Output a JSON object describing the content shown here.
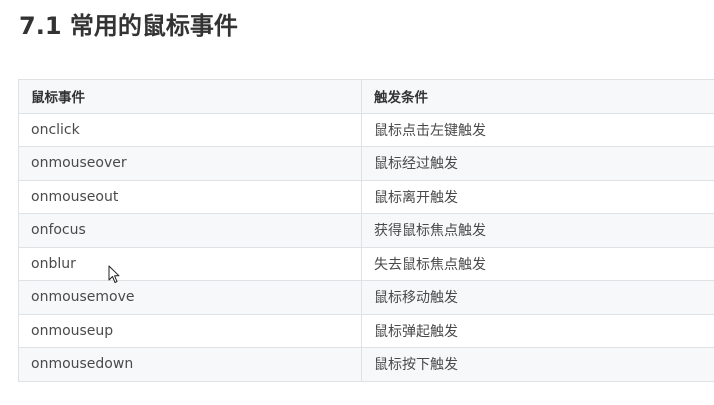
{
  "title": "7.1 常用的鼠标事件",
  "table": {
    "headers": [
      "鼠标事件",
      "触发条件"
    ],
    "rows": [
      {
        "event": "onclick",
        "condition": "鼠标点击左键触发"
      },
      {
        "event": "onmouseover",
        "condition": "鼠标经过触发"
      },
      {
        "event": "onmouseout",
        "condition": "鼠标离开触发"
      },
      {
        "event": "onfocus",
        "condition": "获得鼠标焦点触发"
      },
      {
        "event": "onblur",
        "condition": "失去鼠标焦点触发"
      },
      {
        "event": "onmousemove",
        "condition": "鼠标移动触发"
      },
      {
        "event": "onmouseup",
        "condition": "鼠标弹起触发"
      },
      {
        "event": "onmousedown",
        "condition": "鼠标按下触发"
      }
    ]
  },
  "colors": {
    "text": "#333333",
    "border": "#dfe2e5",
    "stripe": "#f6f8fa"
  },
  "icons": {
    "cursor": "mouse-pointer-icon"
  }
}
